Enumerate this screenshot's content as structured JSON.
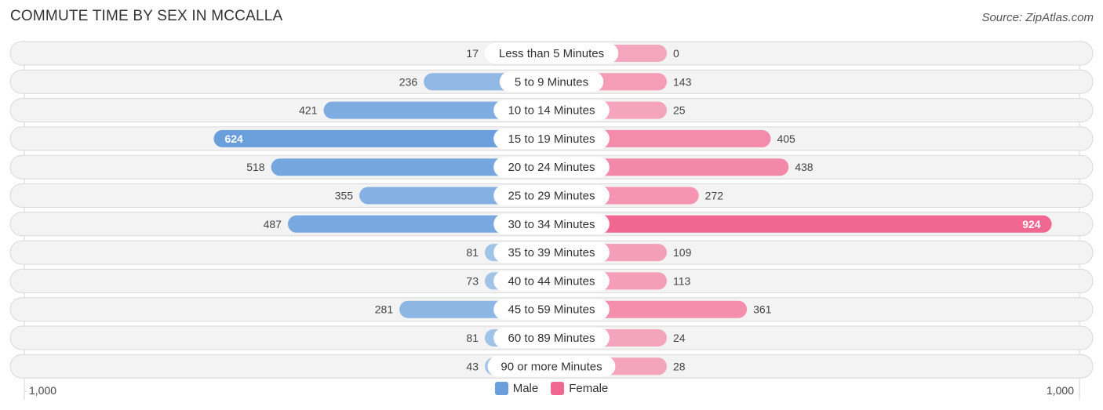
{
  "title": "COMMUTE TIME BY SEX IN MCCALLA",
  "source": "Source: ZipAtlas.com",
  "colors": {
    "male": "#6a9fdc",
    "male_light": "#a8c8ea",
    "female": "#f06892",
    "female_light": "#f5a6bf"
  },
  "legend": [
    {
      "label": "Male",
      "color": "#6a9fdc"
    },
    {
      "label": "Female",
      "color": "#f06892"
    }
  ],
  "chart_data": {
    "type": "bar",
    "orientation": "horizontal-diverging",
    "title": "COMMUTE TIME BY SEX IN MCCALLA",
    "categories": [
      "Less than 5 Minutes",
      "5 to 9 Minutes",
      "10 to 14 Minutes",
      "15 to 19 Minutes",
      "20 to 24 Minutes",
      "25 to 29 Minutes",
      "30 to 34 Minutes",
      "35 to 39 Minutes",
      "40 to 44 Minutes",
      "45 to 59 Minutes",
      "60 to 89 Minutes",
      "90 or more Minutes"
    ],
    "series": [
      {
        "name": "Male",
        "values": [
          17,
          236,
          421,
          624,
          518,
          355,
          487,
          81,
          73,
          281,
          81,
          43
        ]
      },
      {
        "name": "Female",
        "values": [
          0,
          143,
          25,
          405,
          438,
          272,
          924,
          109,
          113,
          361,
          24,
          28
        ]
      }
    ],
    "axis": {
      "left_label": "1,000",
      "right_label": "1,000",
      "max": 1000
    },
    "legend_position": "bottom-center"
  }
}
